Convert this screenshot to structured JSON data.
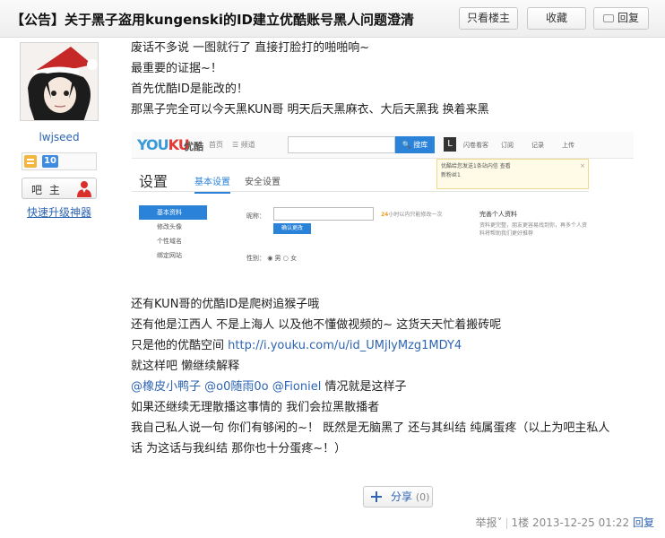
{
  "header": {
    "title": "【公告】关于黑子盗用kungenski的ID建立优酷账号黑人问题澄清",
    "only_op": "只看楼主",
    "favorite": "收藏",
    "reply": "回复"
  },
  "user": {
    "name": "lwjseed",
    "level": "10",
    "role": "吧 主",
    "upgrade": "快速升级神器"
  },
  "post": {
    "lines_top": [
      "废话不多说 一图就行了 直接打脸打的啪啪响~",
      "最重要的证据~！",
      "首先优酷ID是能改的！",
      "那黑子完全可以今天黑KUN哥 明天后天黑麻衣、大后天黑我 换着来黑"
    ],
    "line_a": "还有KUN哥的优酷ID是爬树追猴子哦",
    "line_b": "还有他是江西人 不是上海人 以及他不懂做视频的~ 这货天天忙着搬砖呢",
    "line_c_prefix": "只是他的优酷空间 ",
    "line_c_link": "http://i.youku.com/u/id_UMjlyMzg1MDY4",
    "line_d": "就这样吧 懒继续解释",
    "mention1": "@橡皮小鸭子",
    "mention2": "@o0随雨0o",
    "mention3": "@Fioniel",
    "line_e_suffix": " 情况就是这样子",
    "line_f": "如果还继续无理散播这事情的 我们会拉黑散播者",
    "line_g": "我自己私人说一句 你们有够闲的~！ 既然是无脑黑了 还与其纠结 纯属蛋疼（以上为吧主私人",
    "line_h": "话 为这话与我纠结 那你也十分蛋疼~！）"
  },
  "screenshot": {
    "logo_en_1": "YOU",
    "logo_en_2": "KU",
    "logo_cn": "优酷",
    "home": "首页",
    "channel": "☰ 频道",
    "search_btn": "🔍 搜库",
    "l_icon": "L",
    "nav": [
      "闪卷看客",
      "订阅",
      "记录",
      "上传"
    ],
    "notice_text": "优酷给您发送1条站内信 查看",
    "notice_sub": "新粉丝1",
    "settings": "设置",
    "tab_basic": "基本设置",
    "tab_security": "安全设置",
    "side_menu": [
      "基本资料",
      "修改头像",
      "个性域名",
      "绑定网站"
    ],
    "nick_label": "昵称：",
    "nick_hint_prefix": "24",
    "nick_hint": "小时以内只能修改一次",
    "confirm": "确认更改",
    "gender": "性别：  ◉ 男    ○ 女",
    "profile_title": "完善个人资料",
    "profile_desc": "资料更完整，朋友更容易找到你，再多个人资料将帮助我们更好推荐"
  },
  "share": {
    "label": "分享",
    "count": "(0)"
  },
  "footer": {
    "report": "举报",
    "floor": "1楼",
    "time": "2013-12-25 01:22",
    "reply": "回复"
  }
}
